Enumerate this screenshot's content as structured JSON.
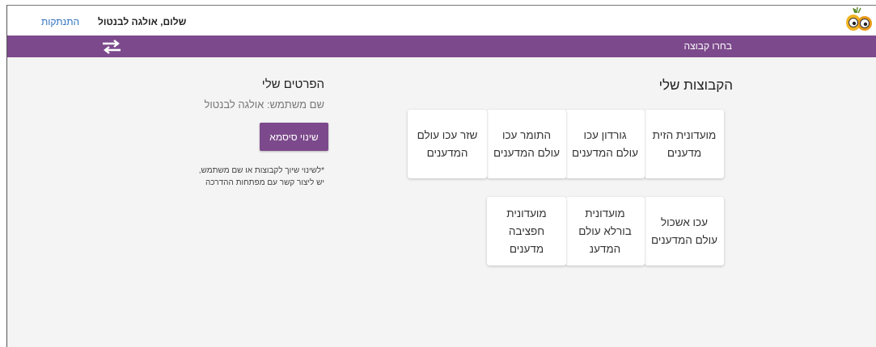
{
  "header": {
    "greeting": "שלום, אולגה לבנטול",
    "logout_label": "התנתקות"
  },
  "navbar": {
    "choose_group_label": "בחרו קבוצה"
  },
  "groups": {
    "title": "הקבוצות שלי",
    "items": [
      {
        "label": "מועדונית הזית מדענים"
      },
      {
        "label": "גורדון עכו עולם המדענים"
      },
      {
        "label": "התומר עכו עולם המדענים"
      },
      {
        "label": "שזר עכו עולם המדענים"
      },
      {
        "label": "עכו אשכול עולם המדענים"
      },
      {
        "label": "מועדונית בורלא עולם המדענ"
      },
      {
        "label": "מועדונית חפציבה מדענים"
      }
    ]
  },
  "details": {
    "title": "הפרטים שלי",
    "username_line": "שם משתמש: אולגה לבנטול",
    "change_password_label": "שינוי סיסמא",
    "note_line1": "*לשינוי שיוך לקבוצות או שם משתמש,",
    "note_line2": "יש ליצור קשר עם מפתחות ההדרכה"
  },
  "colors": {
    "brand_purple": "#7c4a8c",
    "link_blue": "#2f6fbf"
  }
}
